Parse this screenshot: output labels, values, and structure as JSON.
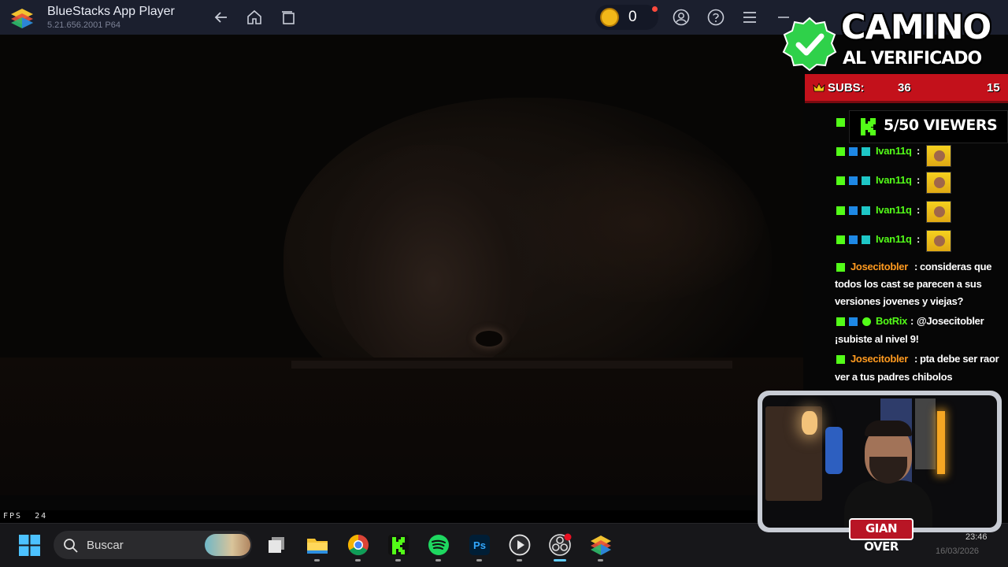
{
  "window": {
    "title": "BlueStacks App Player",
    "version": "5.21.656.2001 P64",
    "coins": "0"
  },
  "game": {
    "fps_label": "FPS",
    "fps_value": "24"
  },
  "taskbar": {
    "search_placeholder": "Buscar",
    "apps": [
      "task-view",
      "file-explorer",
      "chrome",
      "kick",
      "spotify",
      "photoshop",
      "media-player",
      "obs-studio",
      "bluestacks"
    ],
    "clock_time": "23:46",
    "clock_date": "16/03/2026"
  },
  "overlay": {
    "title_line1": "CAMINO",
    "title_line2": "AL VERIFICADO",
    "subs_label": "SUBS:",
    "subs_count": "36",
    "subs_goal": "15",
    "viewers": "5/50 VIEWERS",
    "streamer_tag": "GIAN OVER"
  },
  "chat": [
    {
      "user": "Ivan11q",
      "sep": ":",
      "msg": "",
      "color": "#53fc18",
      "emote": true
    },
    {
      "user": "Ivan11q",
      "sep": ":",
      "msg": "",
      "color": "#53fc18",
      "emote": true
    },
    {
      "user": "Ivan11q",
      "sep": ":",
      "msg": "",
      "color": "#53fc18",
      "emote": true
    },
    {
      "user": "Ivan11q",
      "sep": ":",
      "msg": "",
      "color": "#53fc18",
      "emote": true
    },
    {
      "user": "Josecitobler",
      "sep": ":",
      "msg_line1": "consideras que",
      "msg_line2": "todos los cast se parecen a sus",
      "msg_line3": "versiones jovenes y viejas?",
      "color": "#ff9a1f"
    },
    {
      "user": "BotRix",
      "sep": ":",
      "msg_line1": "@Josecitobler",
      "msg_line2": "¡subiste al nivel 9!",
      "color": "#53fc18"
    },
    {
      "user": "Josecitobler",
      "sep": ":",
      "msg_line1": "pta debe ser raor",
      "msg_line2": "ver a tus padres chibolos",
      "color": "#ff9a1f"
    }
  ],
  "colors": {
    "titlebar": "#1b1f2e",
    "subs_bar": "#c3111b",
    "kick_green": "#53fc18",
    "taskbar": "#17171a"
  }
}
